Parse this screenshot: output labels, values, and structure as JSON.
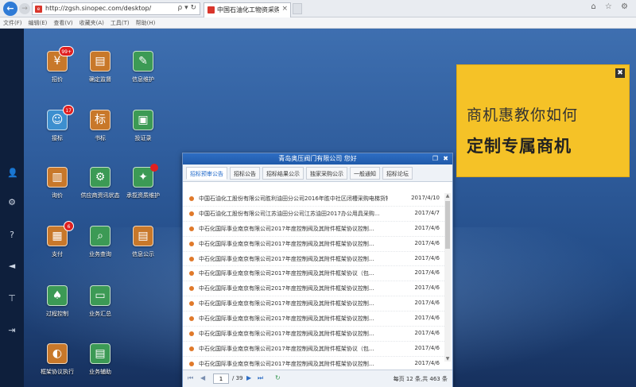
{
  "browser": {
    "url": "http://zgsh.sinopec.com/desktop/",
    "address_controls": "ρ ▾ ↻",
    "tab_title": "中国石油化工物资采购电子...",
    "tab_close": "×",
    "window_icons": "⌂ ☆ ⚙"
  },
  "menu": [
    "文件(F)",
    "编辑(E)",
    "查看(V)",
    "收藏夹(A)",
    "工具(T)",
    "帮助(H)"
  ],
  "sidebar_icons": [
    "user-icon",
    "gear-icon",
    "help-icon",
    "volume-icon",
    "pin-icon",
    "exit-icon"
  ],
  "desktop_icons": [
    {
      "label": "招价",
      "glyph": "¥",
      "badge": "99+",
      "color": "#c8782a"
    },
    {
      "label": "确定监督",
      "glyph": "▤",
      "badge": "",
      "color": "#c8782a"
    },
    {
      "label": "信息维护",
      "glyph": "✎",
      "badge": "",
      "color": "#3c9a55"
    },
    {
      "label": "接标",
      "glyph": "☺",
      "badge": "17",
      "color": "#3d8fcf"
    },
    {
      "label": "书标",
      "glyph": "标",
      "badge": "",
      "color": "#c8782a"
    },
    {
      "label": "投证录",
      "glyph": "▣",
      "badge": "",
      "color": "#3c9a55"
    },
    {
      "label": "询价",
      "glyph": "▥",
      "badge": "",
      "color": "#c8782a"
    },
    {
      "label": "供应商资讯状态",
      "glyph": "⚙",
      "badge": "",
      "color": "#3c9a55"
    },
    {
      "label": "承揽资质维护",
      "glyph": "✦",
      "badge": "dot",
      "color": "#3c9a55"
    },
    {
      "label": "支付",
      "glyph": "▦",
      "badge": "6",
      "color": "#c8782a"
    },
    {
      "label": "业务查询",
      "glyph": "⌕",
      "badge": "",
      "color": "#3c9a55"
    },
    {
      "label": "信息公示",
      "glyph": "▤",
      "badge": "",
      "color": "#c8782a"
    },
    {
      "label": "过程控制",
      "glyph": "♠",
      "badge": "",
      "color": "#3c9a55"
    },
    {
      "label": "业务汇总",
      "glyph": "▭",
      "badge": "",
      "color": "#3c9a55"
    },
    {
      "label": "框架协议执行",
      "glyph": "◐",
      "badge": "",
      "color": "#c8782a"
    },
    {
      "label": "业务辅助",
      "glyph": "▤",
      "badge": "",
      "color": "#3c9a55"
    }
  ],
  "notice": {
    "title": "青岛奥压阀门有限公司 您好",
    "tabs": [
      "招标预审公告",
      "招标公告",
      "招标结果公示",
      "独家采购公示",
      "一般通知",
      "招标论坛"
    ],
    "rows": [
      {
        "title": "中国石油化工股份有限公司胜利油田分公司2016年胜中社区闭槽采购电梯货物招标公告",
        "date": "2017/4/10"
      },
      {
        "title": "中国石油化工股份有限公司江苏油田分公司江苏油田2017办公用具采购...",
        "date": "2017/4/7"
      },
      {
        "title": "中石化国际事业南京有限公司2017年度控制阀及其附件框架协议控制...",
        "date": "2017/4/6"
      },
      {
        "title": "中石化国际事业南京有限公司2017年度控制阀及其附件框架协议控制...",
        "date": "2017/4/6"
      },
      {
        "title": "中石化国际事业南京有限公司2017年度控制阀及其附件框架协议控制...",
        "date": "2017/4/6"
      },
      {
        "title": "中石化国际事业南京有限公司2017年度控制阀及其附件框架协议（包...",
        "date": "2017/4/6"
      },
      {
        "title": "中石化国际事业南京有限公司2017年度控制阀及其附件框架协议控制...",
        "date": "2017/4/6"
      },
      {
        "title": "中石化国际事业南京有限公司2017年度控制阀及其附件框架协议控制...",
        "date": "2017/4/6"
      },
      {
        "title": "中石化国际事业南京有限公司2017年度控制阀及其附件框架协议控制...",
        "date": "2017/4/6"
      },
      {
        "title": "中石化国际事业南京有限公司2017年度控制阀及其附件框架协议控制...",
        "date": "2017/4/6"
      },
      {
        "title": "中石化国际事业南京有限公司2017年度控制阀及其附件框架协议（包...",
        "date": "2017/4/6"
      },
      {
        "title": "中石化国际事业南京有限公司2017年度控制阀及其附件框架协议控制...",
        "date": "2017/4/6"
      }
    ],
    "pager": {
      "page": "1",
      "total_pages": "/ 39",
      "info": "每页 12 条,共 463 条"
    }
  },
  "ad": {
    "line1": "商机惠教你如何",
    "line2": "定制专属商机",
    "close": "✖"
  },
  "colors": {
    "accent": "#2e6ec4",
    "ad_bg": "#f5c227",
    "badge": "#e02020"
  }
}
